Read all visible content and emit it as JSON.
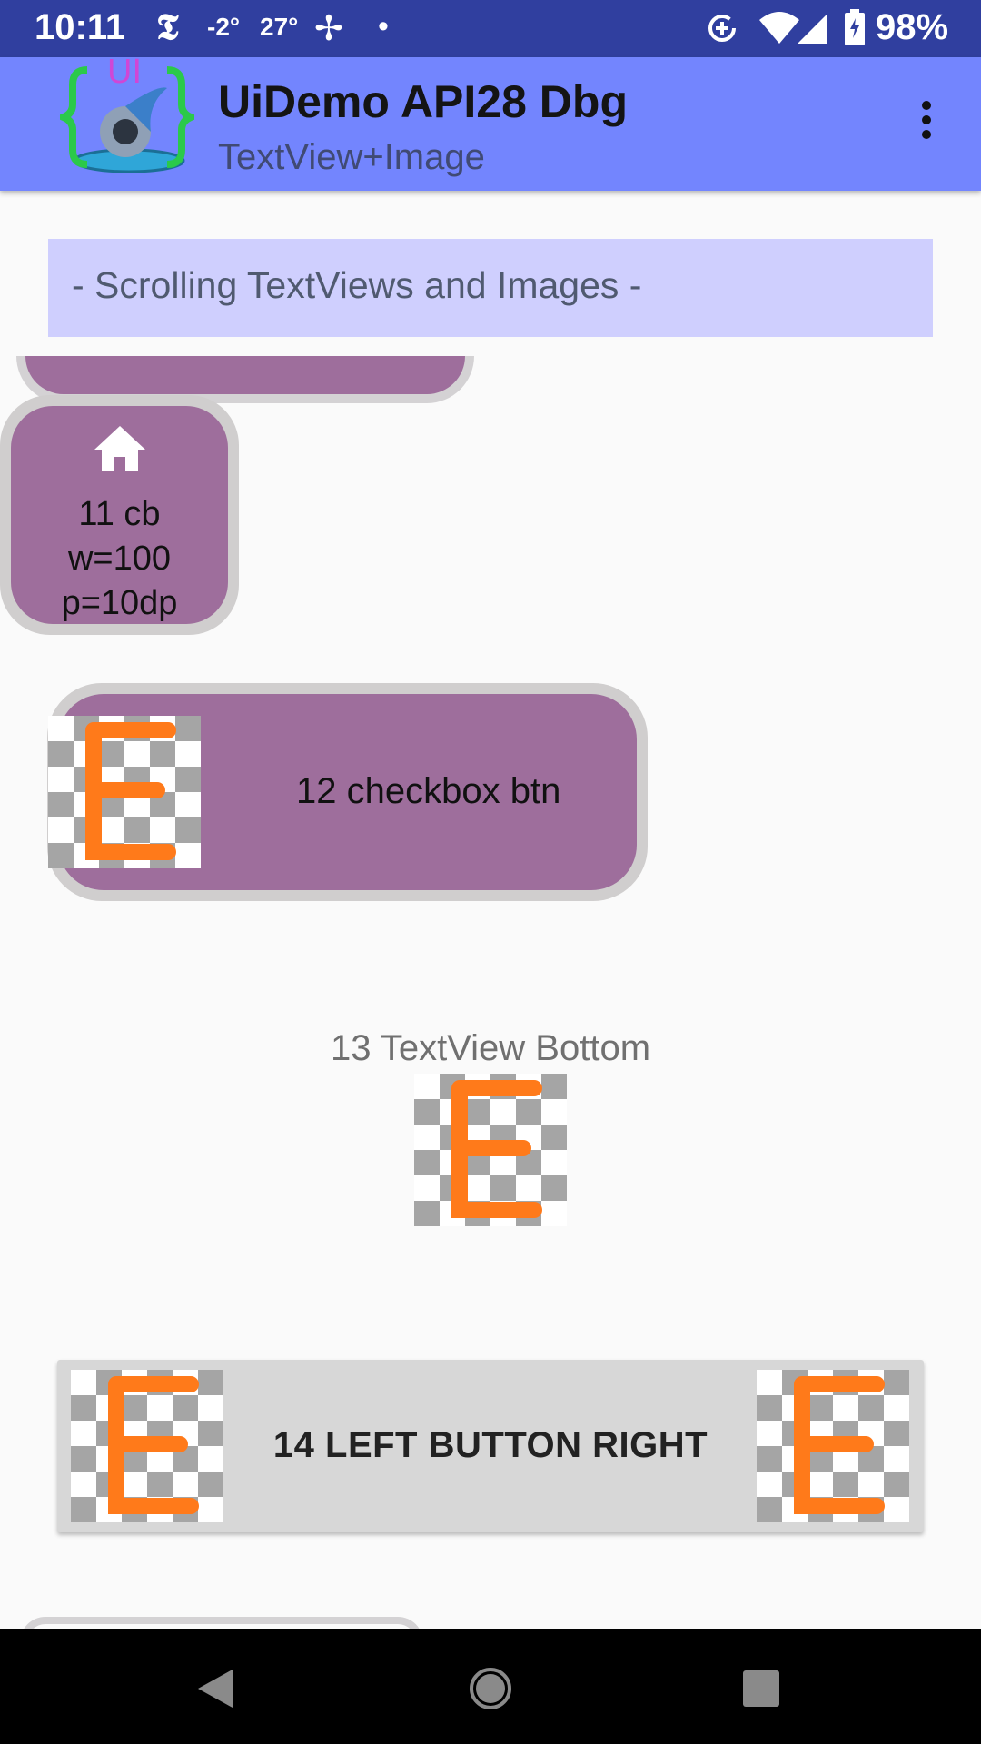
{
  "status_bar": {
    "time": "10:11",
    "news_icon_glyph": "𝕿",
    "temp_low": "-2°",
    "temp_high": "27°",
    "fan_icon_glyph": "✢",
    "dot": "•",
    "battery_percent": "98%"
  },
  "app_bar": {
    "title": "UiDemo API28 Dbg",
    "subtitle": "TextView+Image",
    "logo_text": "UI"
  },
  "header": {
    "text": "- Scrolling TextViews and Images -"
  },
  "items": {
    "cb11": {
      "line1": "11 cb",
      "line2": "w=100",
      "line3": "p=10dp"
    },
    "cb12": {
      "label": "12 checkbox btn"
    },
    "tv13": {
      "label": "13 TextView Bottom"
    },
    "btn14": {
      "label": "14 LEFT BUTTON RIGHT"
    }
  },
  "image_letter": "E",
  "colors": {
    "status_bar": "#303f9f",
    "app_bar": "#7385fe",
    "header_bg": "#cfcffe",
    "checkbox_bg": "#9e6e9c",
    "letter_orange": "#ff7a1a"
  }
}
